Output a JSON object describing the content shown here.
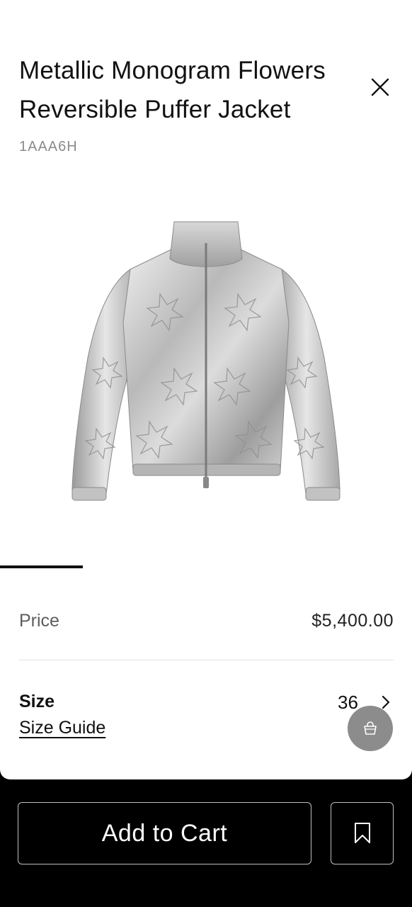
{
  "product": {
    "title": "Metallic Monogram Flowers Reversible Puffer Jacket",
    "sku": "1AAA6H",
    "image_icon": "silver-puffer-jacket-image"
  },
  "price": {
    "label": "Price",
    "value": "$5,400.00"
  },
  "size": {
    "label": "Size",
    "guide_label": "Size Guide",
    "value": "36"
  },
  "actions": {
    "add_to_cart_label": "Add to Cart"
  },
  "icons": {
    "close": "close-icon",
    "size_chevron": "chevron-right-icon",
    "shopping_bag": "shopping-bag-icon",
    "wishlist": "bookmark-icon"
  },
  "colors": {
    "background": "#ffffff",
    "footer": "#000000",
    "fab": "#8c8c8c",
    "text": "#111111",
    "muted": "#8a8a8a"
  }
}
